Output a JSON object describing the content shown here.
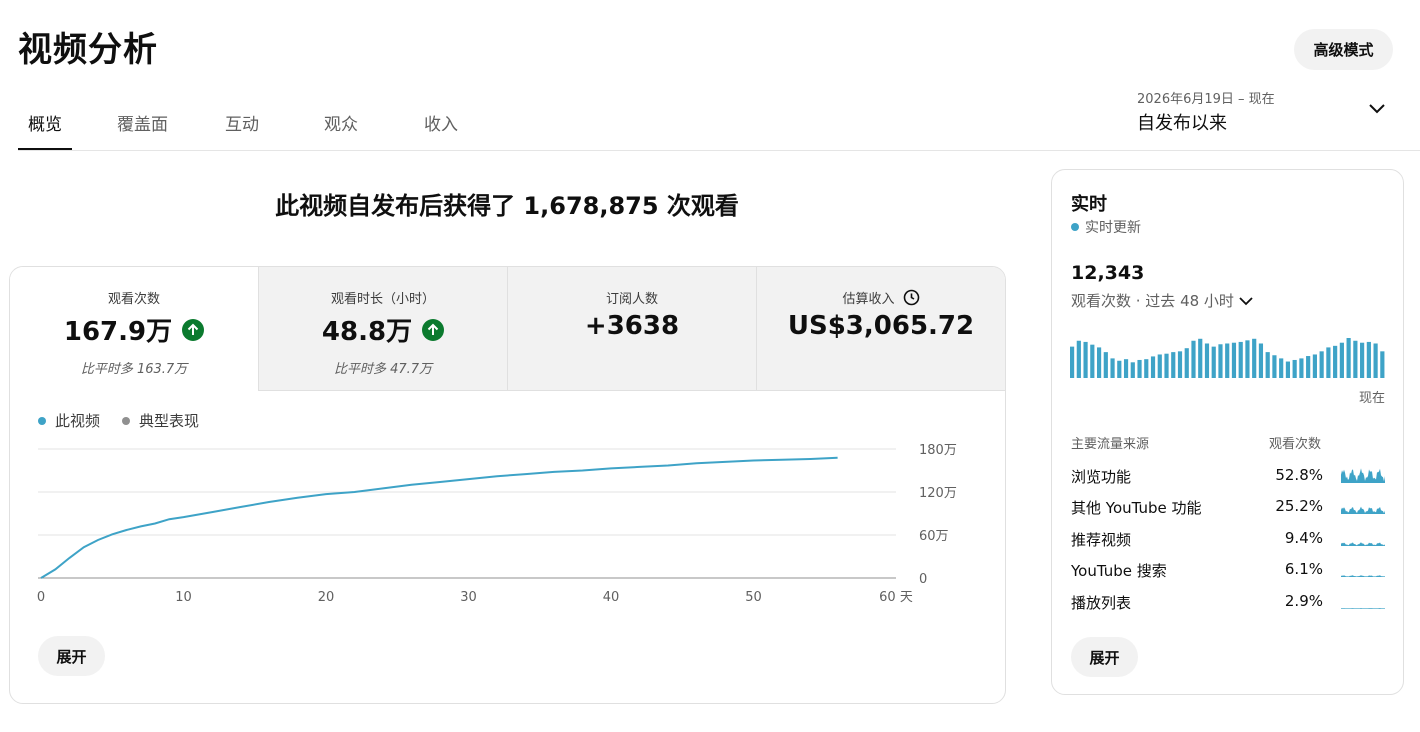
{
  "header": {
    "title": "视频分析",
    "advanced_button": "高级模式"
  },
  "tabs": [
    {
      "label": "概览",
      "active": true
    },
    {
      "label": "覆盖面",
      "active": false
    },
    {
      "label": "互动",
      "active": false
    },
    {
      "label": "观众",
      "active": false
    },
    {
      "label": "收入",
      "active": false
    }
  ],
  "date_range": {
    "sub": "2026年6月19日 – 现在",
    "main": "自发布以来"
  },
  "headline": "此视频自发布后获得了 1,678,875 次观看",
  "metrics": [
    {
      "label": "观看次数",
      "value": "167.9万",
      "compare": "比平时多 163.7万",
      "trend": "up"
    },
    {
      "label": "观看时长（小时）",
      "value": "48.8万",
      "compare": "比平时多 47.7万",
      "trend": "up"
    },
    {
      "label": "订阅人数",
      "value": "+3638",
      "compare": ""
    },
    {
      "label": "估算收入",
      "value": "US$3,065.72",
      "compare": ""
    }
  ],
  "legend": {
    "this_video": "此视频",
    "typical": "典型表现"
  },
  "colors": {
    "accent": "#3ea3c7",
    "typical": "#909090",
    "up": "#0b7a2e"
  },
  "expand_label": "展开",
  "chart_data": {
    "type": "line",
    "xlabel_unit": "天",
    "x_ticks": [
      0,
      10,
      20,
      30,
      40,
      50,
      60
    ],
    "y_ticks": [
      0,
      60,
      120,
      180
    ],
    "y_tick_labels": [
      "0",
      "60万",
      "120万",
      "180万"
    ],
    "xlim": [
      0,
      60
    ],
    "ylim": [
      0,
      180
    ],
    "series": [
      {
        "name": "此视频",
        "x": [
          0,
          1,
          2,
          3,
          4,
          5,
          6,
          7,
          8,
          9,
          10,
          12,
          14,
          16,
          18,
          20,
          22,
          24,
          26,
          28,
          30,
          32,
          34,
          36,
          38,
          40,
          42,
          44,
          46,
          48,
          50,
          52,
          54,
          55.9
        ],
        "y": [
          0,
          12,
          28,
          43,
          53,
          61,
          67,
          72,
          76,
          82,
          85,
          92,
          99,
          106,
          112,
          117,
          120,
          125,
          130,
          134,
          138,
          142,
          145,
          148,
          150,
          153,
          155,
          157,
          160,
          162,
          164,
          165,
          166,
          167.9
        ]
      }
    ]
  },
  "realtime": {
    "title": "实时",
    "live_label": "实时更新",
    "count": "12,343",
    "period": "观看次数 · 过去 48 小时",
    "now_label": "现在",
    "bars": [
      0.8,
      0.95,
      0.92,
      0.85,
      0.78,
      0.66,
      0.5,
      0.44,
      0.48,
      0.4,
      0.46,
      0.48,
      0.55,
      0.6,
      0.62,
      0.66,
      0.68,
      0.76,
      0.95,
      1.0,
      0.88,
      0.8,
      0.86,
      0.88,
      0.9,
      0.92,
      0.96,
      1.0,
      0.88,
      0.66,
      0.58,
      0.5,
      0.42,
      0.46,
      0.5,
      0.56,
      0.6,
      0.68,
      0.78,
      0.82,
      0.9,
      1.02,
      0.95,
      0.9,
      0.92,
      0.88,
      0.68
    ],
    "sources_header": "主要流量来源",
    "views_header": "观看次数",
    "sources": [
      {
        "name": "浏览功能",
        "pct": "52.8%",
        "level": 1.0
      },
      {
        "name": "其他 YouTube 功能",
        "pct": "25.2%",
        "level": 0.5
      },
      {
        "name": "推荐视频",
        "pct": "9.4%",
        "level": 0.25
      },
      {
        "name": "YouTube 搜索",
        "pct": "6.1%",
        "level": 0.12
      },
      {
        "name": "播放列表",
        "pct": "2.9%",
        "level": 0.06
      }
    ]
  }
}
